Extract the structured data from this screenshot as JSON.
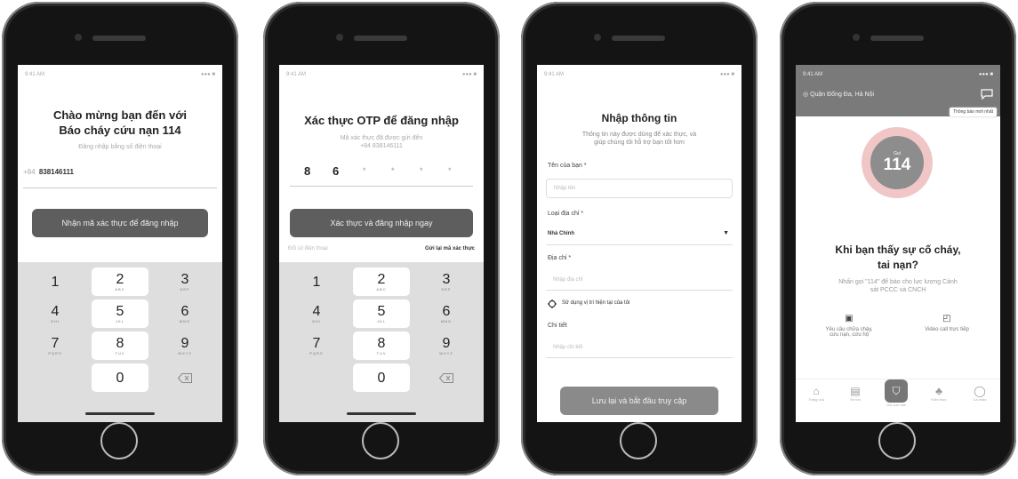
{
  "screen1": {
    "status_time": "9:41 AM",
    "status_right": "●●● ■",
    "title_line1": "Chào mừng bạn đến với",
    "title_line2": "Báo cháy cứu nạn 114",
    "subtitle": "Đăng nhập bằng số điện thoại",
    "country_code": "+84",
    "phone_value": "838146111",
    "button_label": "Nhận mã xác thực để đăng nhập",
    "keys": [
      {
        "n": "1",
        "l": ""
      },
      {
        "n": "2",
        "l": "ABC"
      },
      {
        "n": "3",
        "l": "DEF"
      },
      {
        "n": "4",
        "l": "GHI"
      },
      {
        "n": "5",
        "l": "JKL"
      },
      {
        "n": "6",
        "l": "MNO"
      },
      {
        "n": "7",
        "l": "PQRS"
      },
      {
        "n": "8",
        "l": "TUV"
      },
      {
        "n": "9",
        "l": "WXYZ"
      },
      {
        "n": "0",
        "l": ""
      }
    ]
  },
  "screen2": {
    "status_time": "9:41 AM",
    "status_right": "●●● ■",
    "title": "Xác thực OTP để đăng nhập",
    "subtitle_line1": "Mã xác thực đã được gửi đến",
    "subtitle_line2": "+84 838146111",
    "otp_digits": [
      "8",
      "6",
      "*",
      "*",
      "*",
      "*"
    ],
    "button_label": "Xác thực và đăng nhập ngay",
    "left_link": "Đổi số điện thoại",
    "resend_link": "Gửi lại mã xác thực",
    "keys": [
      {
        "n": "1",
        "l": ""
      },
      {
        "n": "2",
        "l": "ABC"
      },
      {
        "n": "3",
        "l": "DEF"
      },
      {
        "n": "4",
        "l": "GHI"
      },
      {
        "n": "5",
        "l": "JKL"
      },
      {
        "n": "6",
        "l": "MNO"
      },
      {
        "n": "7",
        "l": "PQRS"
      },
      {
        "n": "8",
        "l": "TUV"
      },
      {
        "n": "9",
        "l": "WXYZ"
      },
      {
        "n": "0",
        "l": ""
      }
    ]
  },
  "screen3": {
    "status_time": "9:41 AM",
    "status_right": "●●● ■",
    "title": "Nhập thông tin",
    "subtitle_line1": "Thông tin này được dùng để xác thực, và",
    "subtitle_line2": "giúp chúng tôi hỗ trợ bạn tốt hơn",
    "name_label": "Tên của bạn *",
    "name_placeholder": "Nhập tên",
    "address_type_label": "Loại địa chỉ *",
    "address_type_value": "Nhà Chính",
    "address_label": "Địa chỉ *",
    "address_placeholder": "Nhập địa chỉ",
    "use_location": "Sử dụng vị trí hiện tại của tôi",
    "detail_label": "Chi tiết",
    "detail_placeholder": "Nhập chi tiết",
    "button_label": "Lưu lại và bắt đầu truy cập"
  },
  "screen4": {
    "status_time": "9:41 AM",
    "status_right": "●●● ■",
    "location": "Quận Đống Đa, Hà Nội",
    "notification_tip": "Thông báo mới nhất",
    "badge_small": "Gọi",
    "badge_number": "114",
    "heading_line1": "Khi bạn thấy sự cố cháy,",
    "heading_line2": "tai nạn?",
    "desc_line1": "Nhấn gọi \"114\" để báo cho lực lượng Cảnh",
    "desc_line2": "sát PCCC và CNCH",
    "action1_line1": "Yêu cầu chữa cháy,",
    "action1_line2": "cứu nạn, cứu hộ",
    "action2": "Video call trực tiếp",
    "nav": [
      "Trang chủ",
      "Tin tức",
      "Gọi cứu nạn",
      "Kiến thức",
      "Cá nhân"
    ]
  }
}
